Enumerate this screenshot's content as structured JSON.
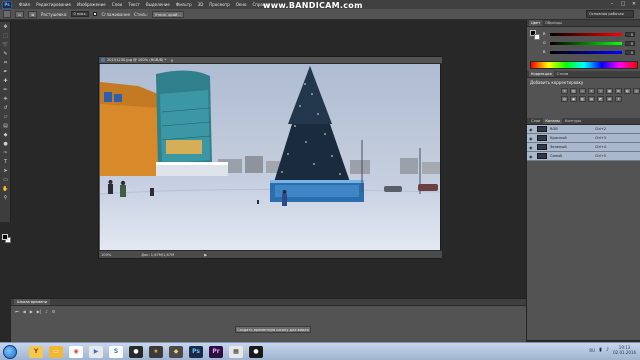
{
  "watermark": "www.BANDICAM.com",
  "menu": [
    "Файл",
    "Редактирование",
    "Изображение",
    "Слои",
    "Текст",
    "Выделение",
    "Фильтр",
    "3D",
    "Просмотр",
    "Окно",
    "Справка"
  ],
  "options": {
    "feather_label": "Растушевка:",
    "feather_value": "0 пикс.",
    "antialias_label": "Сглаживание",
    "style_label": "Стиль:",
    "refine_label": "Уточн. край..."
  },
  "workspace": "Основная рабочая среда",
  "document": {
    "title": "20151230.jpg @ 100% (RGB/8) *",
    "zoom": "100%",
    "doc_size": "Док: 1,67M/1,67M"
  },
  "color_panel": {
    "tabs": [
      "Цвет",
      "Образцы"
    ],
    "channels": [
      {
        "label": "R",
        "value": "0",
        "gradient": "linear-gradient(to right, #000000, #ff0000)"
      },
      {
        "label": "G",
        "value": "0",
        "gradient": "linear-gradient(to right, #000000, #00ff00)"
      },
      {
        "label": "B",
        "value": "0",
        "gradient": "linear-gradient(to right, #000000, #0000ff)"
      }
    ]
  },
  "adjustments": {
    "tabs": [
      "Коррекция",
      "Стили"
    ],
    "title": "Добавить корректировку"
  },
  "layers": {
    "tabs": [
      "Слои",
      "Каналы",
      "Контуры"
    ],
    "rows": [
      {
        "name": "RGB",
        "shortcut": "Ctrl+2"
      },
      {
        "name": "Красный",
        "shortcut": "Ctrl+3"
      },
      {
        "name": "Зеленый",
        "shortcut": "Ctrl+4"
      },
      {
        "name": "Синий",
        "shortcut": "Ctrl+5"
      }
    ]
  },
  "timeline": {
    "tab": "Шкала времени",
    "create_button": "Создать временную шкалу для видео"
  },
  "taskbar": {
    "lang": "RU",
    "time": "19:13",
    "date": "02.01.2016"
  }
}
